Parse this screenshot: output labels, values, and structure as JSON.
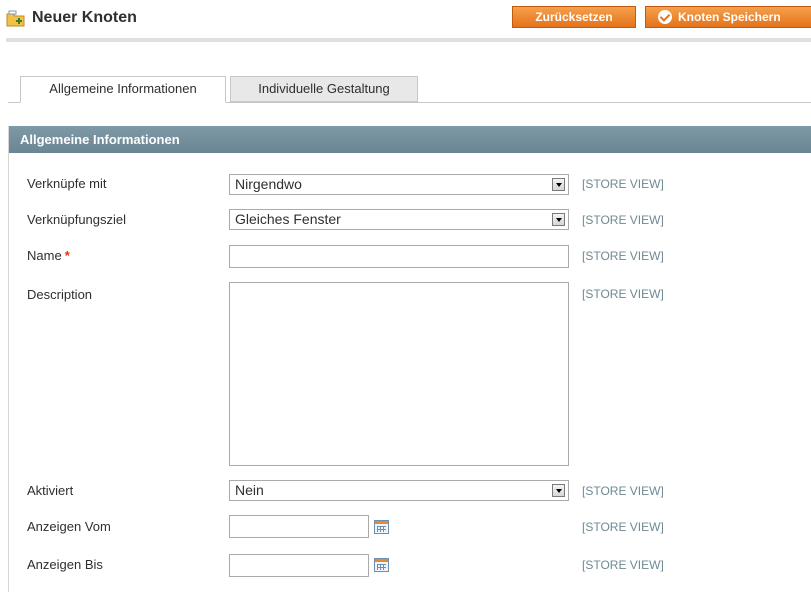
{
  "header": {
    "title": "Neuer Knoten",
    "title_icon": "folder-add-icon",
    "reset_label": "Zurücksetzen",
    "save_label": "Knoten Speichern",
    "accent_color": "#e4731c"
  },
  "tabs": [
    {
      "label": "Allgemeine Informationen",
      "active": true
    },
    {
      "label": "Individuelle Gestaltung",
      "active": false
    }
  ],
  "panel": {
    "title": "Allgemeine Informationen",
    "header_color": "#6a8593"
  },
  "fields": {
    "link_to": {
      "label": "Verknüpfe mit",
      "value": "Nirgendwo",
      "scope": "[STORE VIEW]"
    },
    "link_target": {
      "label": "Verknüpfungsziel",
      "value": "Gleiches Fenster",
      "scope": "[STORE VIEW]"
    },
    "name": {
      "label": "Name",
      "required_mark": "*",
      "value": "",
      "scope": "[STORE VIEW]"
    },
    "description": {
      "label": "Description",
      "value": "",
      "scope": "[STORE VIEW]"
    },
    "active": {
      "label": "Aktiviert",
      "value": "Nein",
      "scope": "[STORE VIEW]"
    },
    "show_from": {
      "label": "Anzeigen Vom",
      "value": "",
      "scope": "[STORE VIEW]",
      "icon": "calendar-icon"
    },
    "show_to": {
      "label": "Anzeigen Bis",
      "value": "",
      "scope": "[STORE VIEW]",
      "icon": "calendar-icon"
    }
  }
}
